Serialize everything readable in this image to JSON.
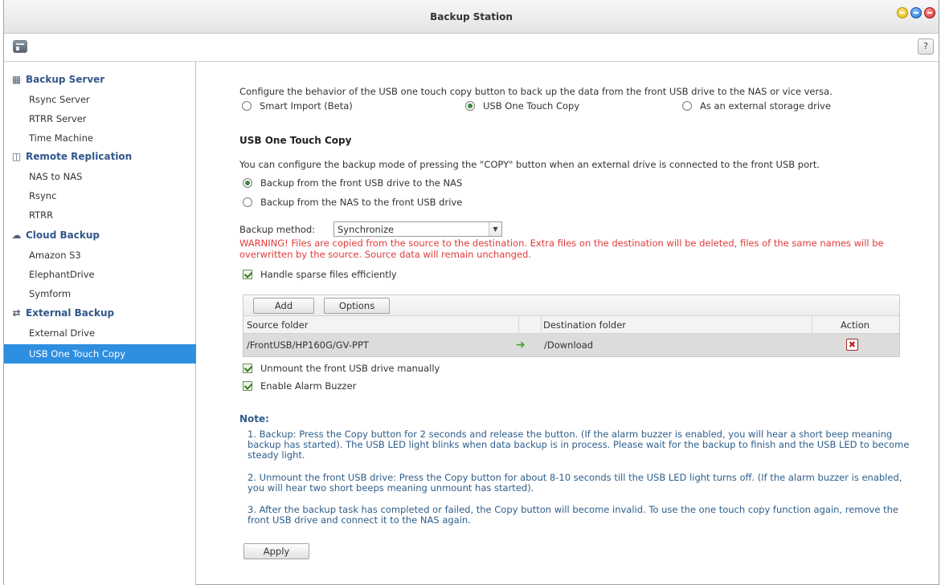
{
  "window": {
    "title": "Backup Station"
  },
  "toolbar": {
    "help_label": "?"
  },
  "sidebar": {
    "groups": [
      {
        "label": "Backup Server",
        "items": [
          "Rsync Server",
          "RTRR Server",
          "Time Machine"
        ]
      },
      {
        "label": "Remote Replication",
        "items": [
          "NAS to NAS",
          "Rsync",
          "RTRR"
        ]
      },
      {
        "label": "Cloud Backup",
        "items": [
          "Amazon S3",
          "ElephantDrive",
          "Symform"
        ]
      },
      {
        "label": "External Backup",
        "items": [
          "External Drive",
          "USB One Touch Copy"
        ]
      }
    ],
    "active_item": "USB One Touch Copy"
  },
  "main": {
    "intro": "Configure the behavior of the USB one touch copy button to back up the data from the front USB drive to the NAS or vice versa.",
    "mode_options": [
      "Smart Import (Beta)",
      "USB One Touch Copy",
      "As an external storage drive"
    ],
    "mode_selected": "USB One Touch Copy",
    "section_title": "USB One Touch Copy",
    "section_desc": "You can configure the backup mode of pressing the \"COPY\" button when an external drive is connected to the front USB port.",
    "direction_options": [
      "Backup from the front USB drive to the NAS",
      "Backup from the NAS to the front USB drive"
    ],
    "direction_selected": "Backup from the front USB drive to the NAS",
    "backup_method_label": "Backup method:",
    "backup_method_value": "Synchronize",
    "warning": "WARNING! Files are copied from the source to the destination. Extra files on the destination will be deleted, files of the same names will be overwritten by the source. Source data will remain unchanged.",
    "sparse_label": "Handle sparse files efficiently",
    "sparse_checked": true,
    "grid": {
      "add_label": "Add",
      "options_label": "Options",
      "columns": [
        "Source folder",
        "Destination folder",
        "Action"
      ],
      "rows": [
        {
          "source": "/FrontUSB/HP160G/GV-PPT",
          "destination": "/Download"
        }
      ]
    },
    "unmount_label": "Unmount the front USB drive manually",
    "unmount_checked": true,
    "alarm_label": "Enable Alarm Buzzer",
    "alarm_checked": true,
    "note_title": "Note:",
    "notes": [
      "1. Backup: Press the Copy button for 2 seconds and release the button. (If the alarm buzzer is enabled, you will hear a short beep meaning backup has started). The USB LED light blinks when data backup is in process. Please wait for the backup to finish and the USB LED to become steady light.",
      "2. Unmount the front USB drive: Press the Copy button for about 8-10 seconds till the USB LED light turns off. (If the alarm buzzer is enabled, you will hear two short beeps meaning unmount has started).",
      "3. After the backup task has completed or failed, the Copy button will become invalid. To use the one touch copy function again, remove the front USB drive and connect it to the NAS again."
    ],
    "apply_label": "Apply"
  },
  "colors": {
    "accent": "#2e8ee0",
    "group_text": "#31578b",
    "warning": "#e03a3a",
    "note_text": "#2e5e8a"
  }
}
